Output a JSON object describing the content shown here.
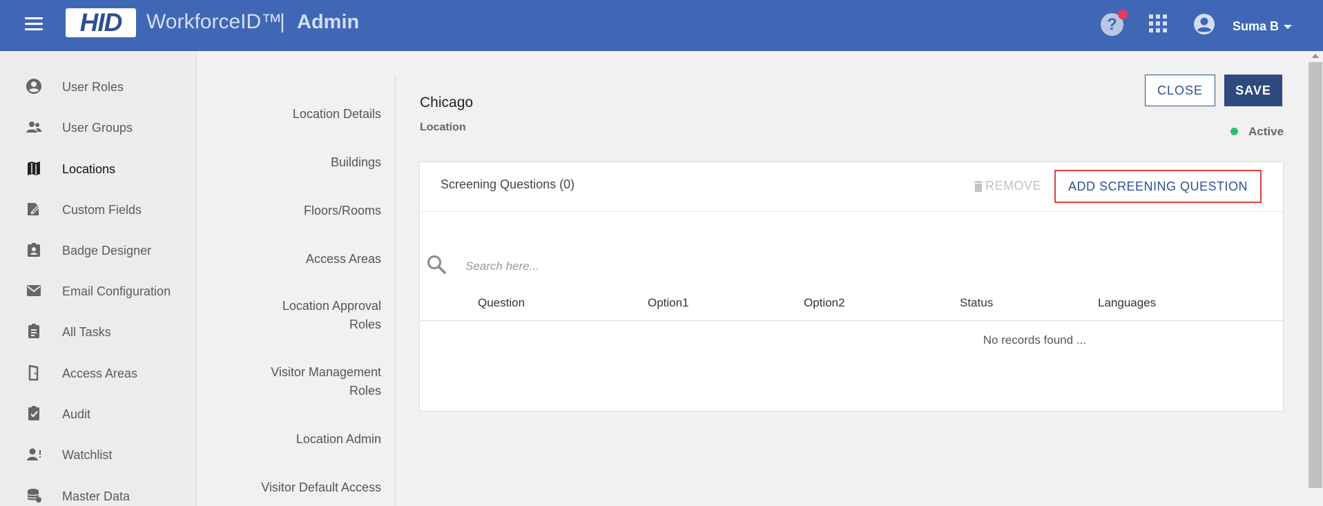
{
  "header": {
    "logo": "HID",
    "product": "WorkforceID™",
    "separator": "|",
    "section": "Admin",
    "user_name": "Suma B",
    "help_icon_text": "?"
  },
  "sidebar": {
    "items": [
      {
        "label": "User Roles",
        "icon": "user-roles-icon",
        "active": false
      },
      {
        "label": "User Groups",
        "icon": "user-groups-icon",
        "active": false
      },
      {
        "label": "Locations",
        "icon": "map-icon",
        "active": true
      },
      {
        "label": "Custom Fields",
        "icon": "custom-fields-icon",
        "active": false
      },
      {
        "label": "Badge Designer",
        "icon": "badge-icon",
        "active": false
      },
      {
        "label": "Email Configuration",
        "icon": "email-icon",
        "active": false
      },
      {
        "label": "All Tasks",
        "icon": "clipboard-icon",
        "active": false
      },
      {
        "label": "Access Areas",
        "icon": "door-icon",
        "active": false
      },
      {
        "label": "Audit",
        "icon": "audit-icon",
        "active": false
      },
      {
        "label": "Watchlist",
        "icon": "watchlist-icon",
        "active": false
      },
      {
        "label": "Master Data",
        "icon": "database-icon",
        "active": false
      }
    ]
  },
  "subnav": {
    "items": [
      {
        "line1": "Location Details"
      },
      {
        "line1": "Buildings"
      },
      {
        "line1": "Floors/Rooms"
      },
      {
        "line1": "Access Areas"
      },
      {
        "line1": "Location Approval",
        "line2": "Roles"
      },
      {
        "line1": "Visitor Management",
        "line2": "Roles"
      },
      {
        "line1": "Location Admin"
      },
      {
        "line1": "Visitor Default Access"
      }
    ]
  },
  "main": {
    "title": "Chicago",
    "subtitle": "Location",
    "close_label": "CLOSE",
    "save_label": "SAVE",
    "status": "Active",
    "status_color": "#2dbf6a"
  },
  "card": {
    "title": "Screening Questions (0)",
    "remove_label": "REMOVE",
    "add_label": "ADD SCREENING QUESTION",
    "search_placeholder": "Search here...",
    "columns": [
      "Question",
      "Option1",
      "Option2",
      "Status",
      "Languages"
    ],
    "empty_message": "No records found ..."
  },
  "colors": {
    "header_bg": "#3f67b5",
    "primary": "#2e4f91",
    "highlight_border": "#e03c3c"
  }
}
